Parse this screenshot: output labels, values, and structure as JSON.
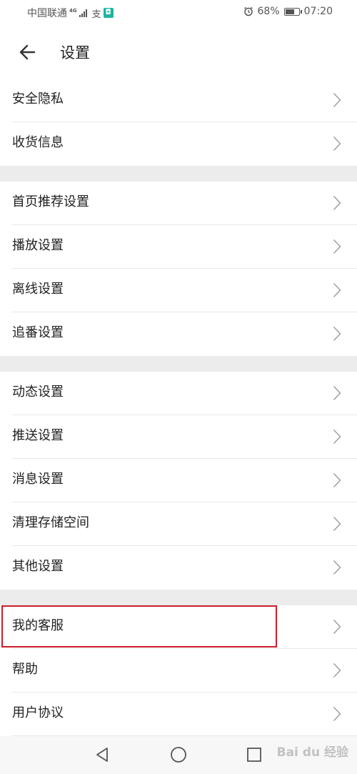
{
  "status_bar": {
    "carrier": "中国联通",
    "network_type": "4G",
    "pay_icon_label": "支",
    "battery_percent_text": "68%",
    "battery_level": 0.68,
    "time": "07:20"
  },
  "header": {
    "title": "设置",
    "back_icon": "arrow-left-icon"
  },
  "sections": [
    {
      "items": [
        {
          "label": "安全隐私"
        },
        {
          "label": "收货信息"
        }
      ]
    },
    {
      "items": [
        {
          "label": "首页推荐设置"
        },
        {
          "label": "播放设置"
        },
        {
          "label": "离线设置"
        },
        {
          "label": "追番设置"
        }
      ]
    },
    {
      "items": [
        {
          "label": "动态设置"
        },
        {
          "label": "推送设置"
        },
        {
          "label": "消息设置"
        },
        {
          "label": "清理存储空间"
        },
        {
          "label": "其他设置"
        }
      ]
    },
    {
      "items": [
        {
          "label": "我的客服"
        },
        {
          "label": "帮助"
        },
        {
          "label": "用户协议"
        }
      ]
    }
  ],
  "nav_bar": {
    "back": "triangle-back-icon",
    "home": "circle-home-icon",
    "recent": "square-recent-icon"
  },
  "watermark": "Bai du 经验",
  "colors": {
    "highlight": "#cc1e2a",
    "section_gap": "#ececec",
    "app_badge": "#1fb3a0"
  }
}
